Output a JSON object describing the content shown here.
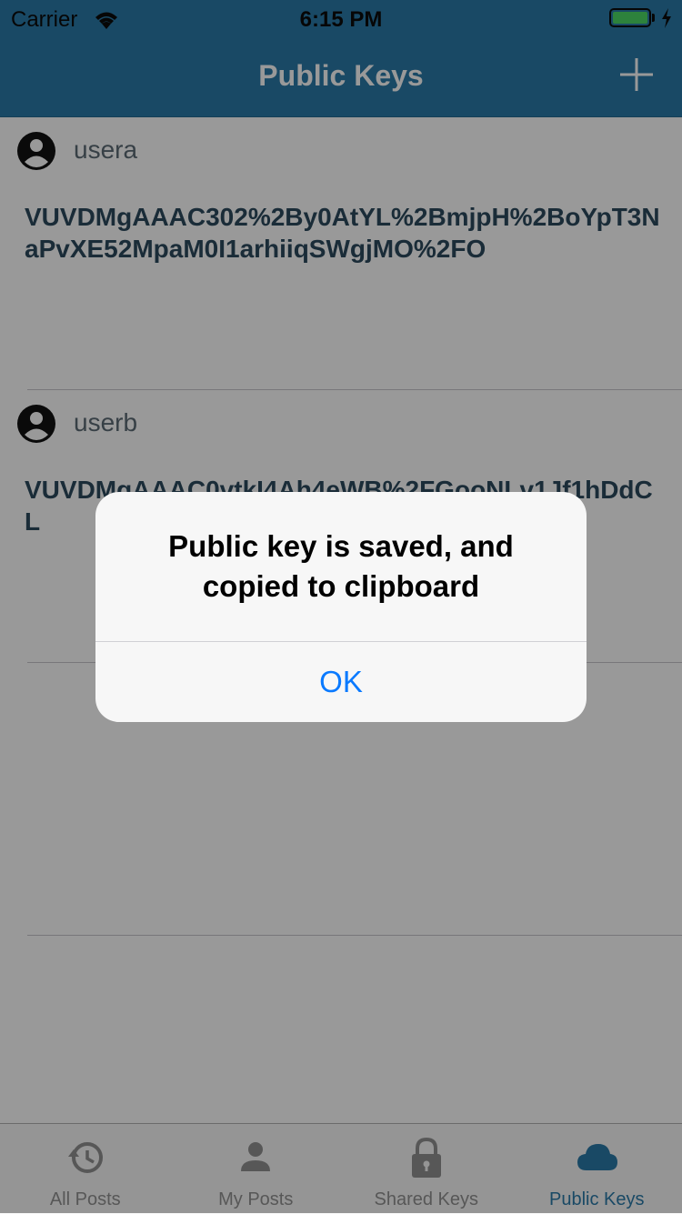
{
  "status_bar": {
    "carrier": "Carrier",
    "time": "6:15 PM",
    "wifi_icon": "wifi-icon",
    "battery_icon": "battery-icon",
    "battery_color": "#4cd964"
  },
  "nav": {
    "title": "Public Keys",
    "add_icon": "plus-icon",
    "background": "#2a7aa8"
  },
  "keys": [
    {
      "username": "usera",
      "avatar_icon": "account-circle-icon",
      "key": "VUVDMgAAAC302%2By0AtYL%2BmjpH%2BoYpT3NaPvXE52MpaM0I1arhiiqSWgjMO%2FO"
    },
    {
      "username": "userb",
      "avatar_icon": "account-circle-icon",
      "key": "VUVDMgAAAC0vtkI4Ah4eWB%2FGooNLv1Jf1hDdCL"
    }
  ],
  "tabs": [
    {
      "label": "All Posts",
      "icon": "history-icon",
      "active": false
    },
    {
      "label": "My Posts",
      "icon": "person-icon",
      "active": false
    },
    {
      "label": "Shared Keys",
      "icon": "lock-icon",
      "active": false
    },
    {
      "label": "Public Keys",
      "icon": "cloud-icon",
      "active": true
    }
  ],
  "alert": {
    "message": "Public key is saved, and copied to clipboard",
    "ok_label": "OK",
    "button_color": "#0a7aff"
  }
}
